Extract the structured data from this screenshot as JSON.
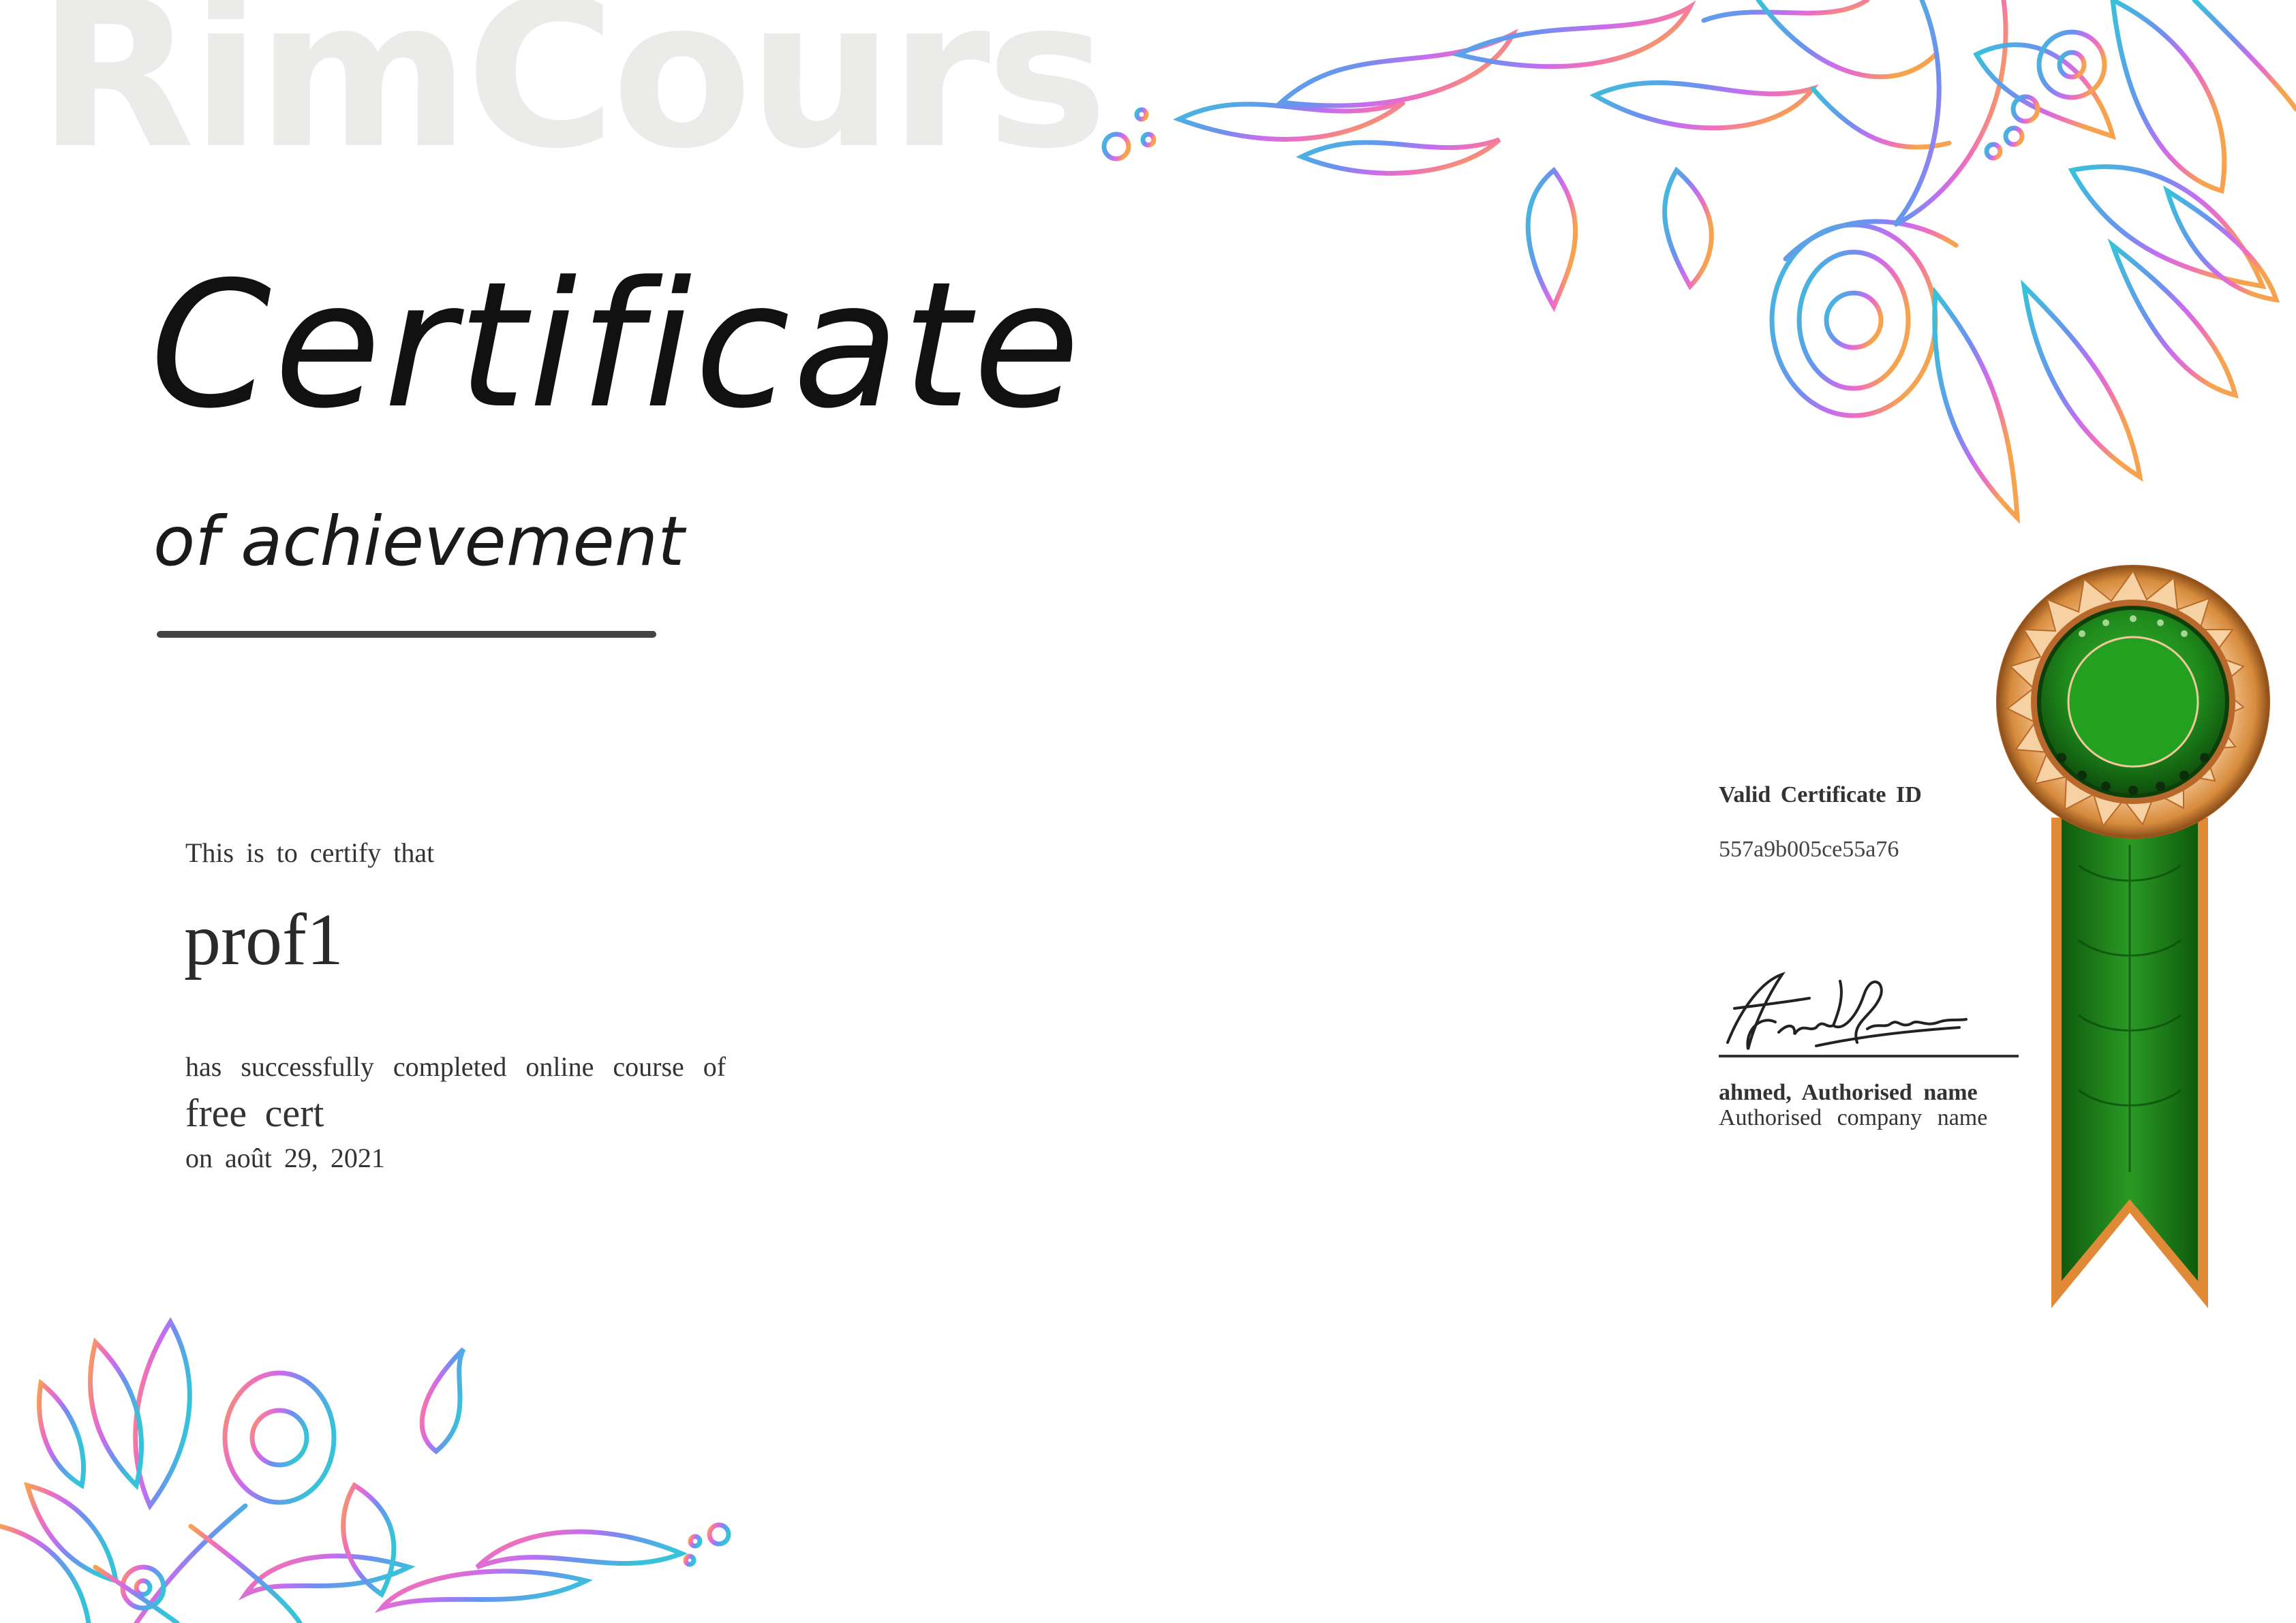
{
  "watermark": {
    "text": "RimCours"
  },
  "certificate": {
    "title": "Certificate",
    "subtitle": "of achievement",
    "certify_intro": "This is to certify  that",
    "recipient": "prof1",
    "completed_text": "has successfully  completed  online course  of",
    "course_name": "free cert",
    "date_line": "on août 29, 2021"
  },
  "validation": {
    "label": "Valid Certificate ID",
    "id": "557a9b005ce55a76"
  },
  "signature": {
    "script_text": "Frank Sinatra",
    "signer_name": "ahmed, Authorised name",
    "company": "Authorised  company  name"
  },
  "colors": {
    "accent_green": "#1f8a1c",
    "accent_copper": "#d78b3c",
    "deco_cyan": "#37c2d9",
    "deco_violet": "#b06cf0",
    "deco_pink": "#f070b8",
    "deco_orange": "#f7a24f"
  },
  "icons": [
    "mandala-ornament-icon",
    "award-rosette-icon",
    "signature-icon"
  ]
}
